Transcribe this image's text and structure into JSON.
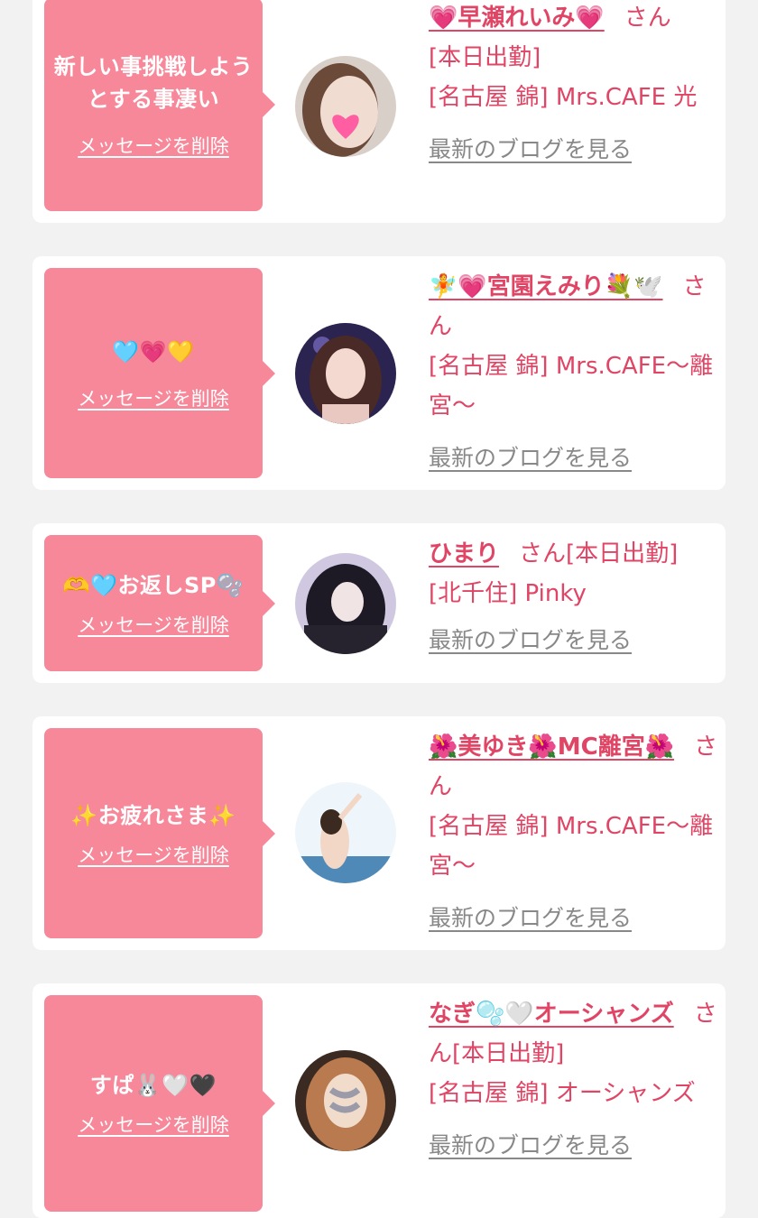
{
  "delete_label": "メッセージを削除",
  "blog_label": "最新のブログを見る",
  "honorific": "さん",
  "colors": {
    "accent": "#e04565",
    "bubble": "#f7889a",
    "link_gray": "#888888",
    "background": "#f2f2f2"
  },
  "messages": [
    {
      "text": "新しい事挑戦しようとする事凄い",
      "name": "💗早瀬れいみ💗",
      "status": "[本日出勤]",
      "shop": "[名古屋 錦] Mrs.CAFE 光",
      "avatar_icon": "avatar-photo"
    },
    {
      "text": "🩵💗💛",
      "name": "🧚💗宮園えみり💐🕊️",
      "status": "",
      "shop": "[名古屋 錦] Mrs.CAFE〜離宮〜",
      "avatar_icon": "avatar-photo"
    },
    {
      "text": "🫶🩵お返しSP🫧",
      "name": "ひまり",
      "status": "[本日出勤]",
      "shop": "[北千住] Pinky",
      "avatar_icon": "avatar-photo"
    },
    {
      "text": "✨お疲れさま✨",
      "name": "🌺美ゆき🌺MC離宮🌺",
      "status": "",
      "shop": "[名古屋 錦] Mrs.CAFE〜離宮〜",
      "avatar_icon": "avatar-photo"
    },
    {
      "text": "すぱ🐰🤍🖤",
      "name": "なぎ🫧🤍オーシャンズ",
      "status": "[本日出勤]",
      "shop": "[名古屋 錦] オーシャンズ",
      "avatar_icon": "avatar-photo"
    }
  ]
}
